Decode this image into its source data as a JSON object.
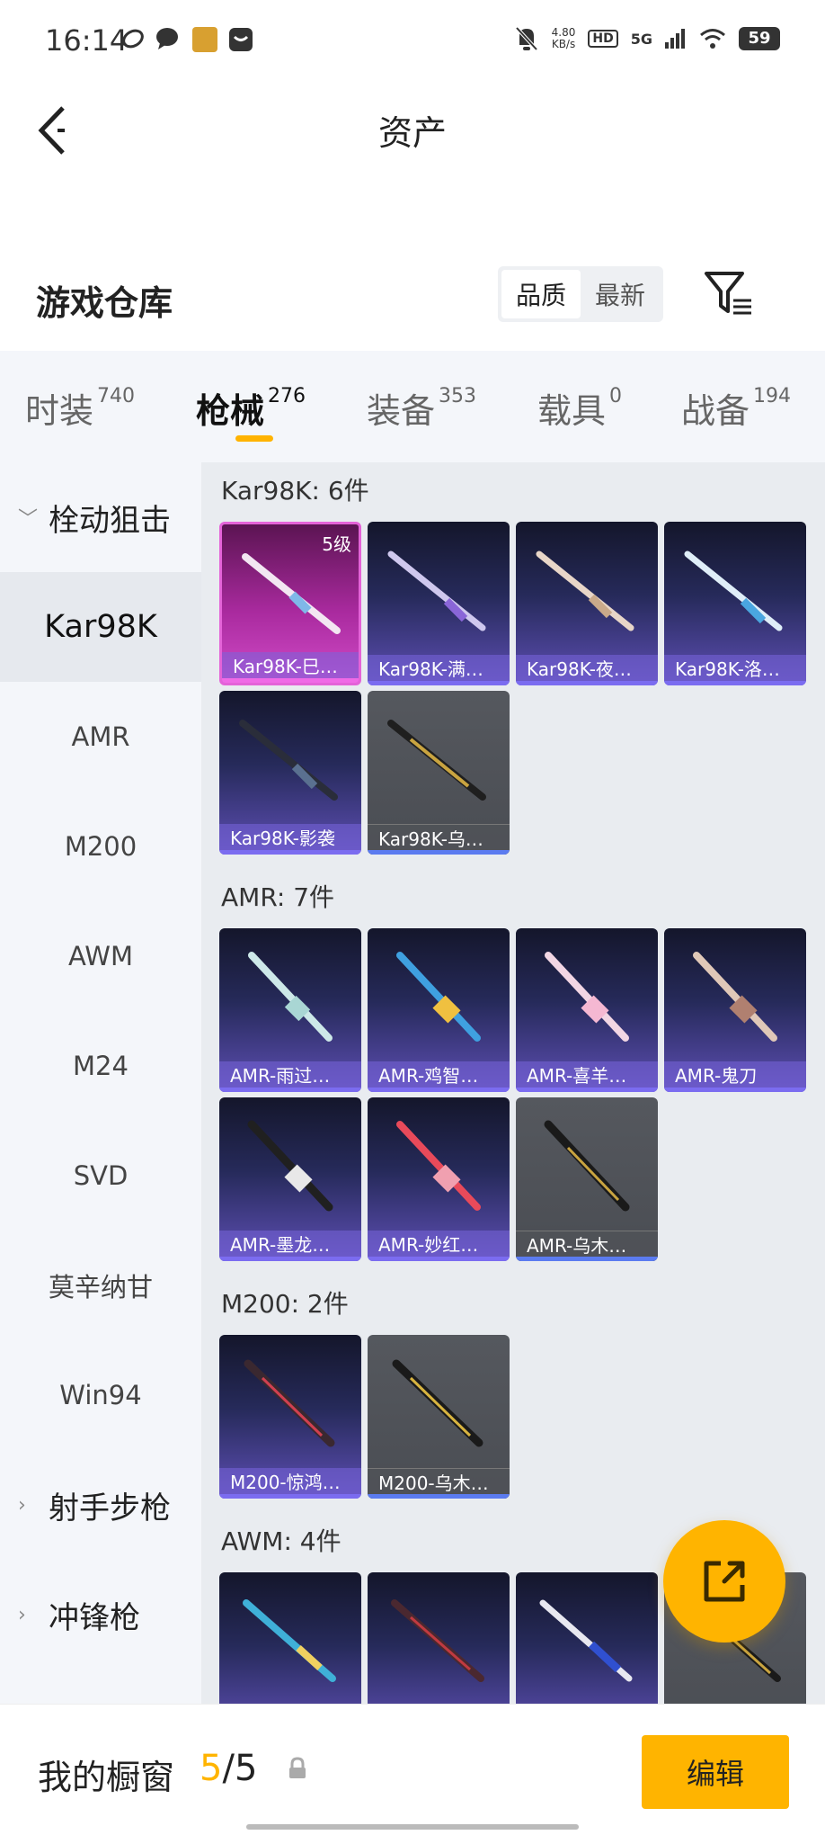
{
  "status_bar": {
    "time": "16:14",
    "net_speed_value": "4.80",
    "net_speed_unit": "KB/s",
    "hd": "HD",
    "network": "5G",
    "battery": "59"
  },
  "header": {
    "title": "资产"
  },
  "warehouse": {
    "title": "游戏仓库",
    "sort_options": [
      "品质",
      "最新"
    ],
    "active_sort": "品质"
  },
  "tabs": [
    {
      "label": "时装",
      "count": "740"
    },
    {
      "label": "枪械",
      "count": "276"
    },
    {
      "label": "装备",
      "count": "353"
    },
    {
      "label": "载具",
      "count": "0"
    },
    {
      "label": "战备",
      "count": "194"
    }
  ],
  "sidebar": {
    "group_open": "栓动狙击",
    "items": [
      "Kar98K",
      "AMR",
      "M200",
      "AWM",
      "M24",
      "SVD",
      "莫辛纳甘",
      "Win94"
    ],
    "groups_closed": [
      "射手步枪",
      "冲锋枪"
    ]
  },
  "sections": [
    {
      "title": "Kar98K: 6件",
      "cards": [
        {
          "name": "Kar98K-巳…",
          "level": "5级"
        },
        {
          "name": "Kar98K-满…"
        },
        {
          "name": "Kar98K-夜…"
        },
        {
          "name": "Kar98K-洛…"
        },
        {
          "name": "Kar98K-影袭"
        },
        {
          "name": "Kar98K-乌…"
        }
      ]
    },
    {
      "title": "AMR: 7件",
      "cards": [
        {
          "name": "AMR-雨过…"
        },
        {
          "name": "AMR-鸡智…"
        },
        {
          "name": "AMR-喜羊…"
        },
        {
          "name": "AMR-鬼刀"
        },
        {
          "name": "AMR-墨龙…"
        },
        {
          "name": "AMR-妙红…"
        },
        {
          "name": "AMR-乌木…"
        }
      ]
    },
    {
      "title": "M200: 2件",
      "cards": [
        {
          "name": "M200-惊鸿…"
        },
        {
          "name": "M200-乌木…"
        }
      ]
    },
    {
      "title": "AWM: 4件",
      "cards": [
        {
          "name": ""
        },
        {
          "name": ""
        },
        {
          "name": ""
        },
        {
          "name": ""
        }
      ]
    }
  ],
  "bottom_bar": {
    "label": "我的橱窗",
    "current": "5",
    "separator": "/",
    "total": "5",
    "edit_label": "编辑"
  },
  "colors": {
    "accent": "#ffb400",
    "rarity_purple": "#5e4fb5",
    "rarity_pink": "#d14bc8",
    "rarity_gray": "#55585e"
  }
}
